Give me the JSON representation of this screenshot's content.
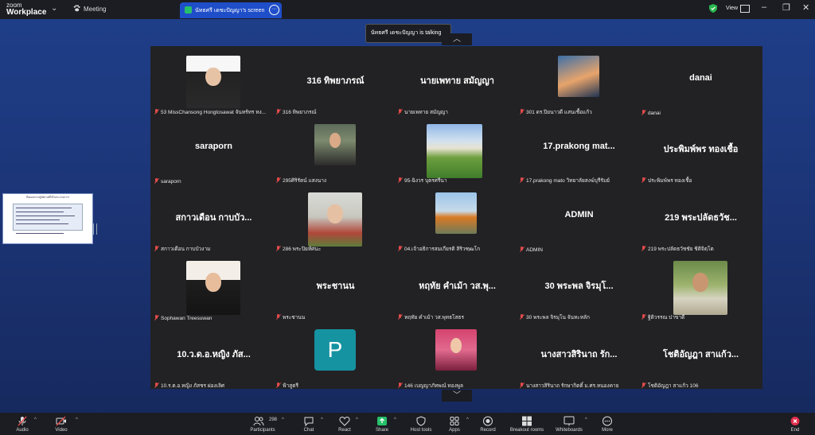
{
  "app": {
    "logo_top": "zoom",
    "logo_bottom": "Workplace",
    "meeting_label": "Meeting"
  },
  "share_tab": {
    "title": "นัทธศรี เดชะปัญญา's screen",
    "more": "···"
  },
  "topbar_right": {
    "view_label": "View",
    "minimize": "–",
    "restore": "❐",
    "close": "✕"
  },
  "talking": "นัทธศรี เดชะปัญญา is talking...",
  "carets": {
    "up": "︿",
    "down": "﹀"
  },
  "tiles": [
    {
      "type": "photo",
      "name": "53 MissChansong Hongtosawat จันทร์ทร หง..."
    },
    {
      "type": "text",
      "big": "316 ทิพยาภรณ์",
      "name": "316 ทิพยาภรณ์"
    },
    {
      "type": "text",
      "big": "นายเพทาย สมัญญา",
      "name": "นายเพทาย สมัญญา"
    },
    {
      "type": "photo",
      "name": "301 ดร.ปิยนาวดี แสนเชื้อแก้ว"
    },
    {
      "type": "text",
      "big": "danai",
      "name": "danai"
    },
    {
      "type": "text",
      "big": "saraporn",
      "name": "saraporn"
    },
    {
      "type": "photo",
      "name": "295ศิริรัตน์ แสงนาง"
    },
    {
      "type": "photo",
      "name": "95-ฉิงวร บุตรศรีนา"
    },
    {
      "type": "text",
      "big": "17.prakong mat...",
      "name": "17.prakong mato วิทยาลัยสงฆ์บุรีรัมย์"
    },
    {
      "type": "text",
      "big": "ประพิมพ์พร ทองเชื้อ",
      "name": "ประพิมพ์พร ทองเชื้อ"
    },
    {
      "type": "text",
      "big": "สกาวเดือน กาบบัว...",
      "name": "สกาวเดือน กาบบัวงาม"
    },
    {
      "type": "photo",
      "name": "286 พระปิยทัศนะ"
    },
    {
      "type": "photo",
      "name": "04.เจ้าอธิการสมเกียรติ สิริวฑฺฒโก"
    },
    {
      "type": "text",
      "big": "ADMIN",
      "name": "ADMIN"
    },
    {
      "type": "text",
      "big": "219 พระปลัดธวัช...",
      "name": "219 พระปลัดธวัชชัย ชิติจิตฺโต"
    },
    {
      "type": "photo",
      "name": "Sophawan Treesuwan"
    },
    {
      "type": "text",
      "big": "พระชานน",
      "name": "พระชานน"
    },
    {
      "type": "text",
      "big": "หฤทัย คำเม้า วส.พุ...",
      "name": "หฤทัย คำเม้า วส.พุทธโสธร"
    },
    {
      "type": "text",
      "big": "30 พระพล จิรมุโ...",
      "name": "30 พระพล จิรมุโน จันทะหลัก"
    },
    {
      "type": "photo",
      "name": "ฐิติวรรณ ปาขาดี"
    },
    {
      "type": "text",
      "big": "10.ว.ด.อ.หญิง ภัส...",
      "name": "10.ร.ต.อ.หญิง ภัสชร ผ่องเลิศ"
    },
    {
      "type": "avatar",
      "letter": "P",
      "name": "ฟ้าสูตรี"
    },
    {
      "type": "photo",
      "name": "146 เบญญาภัทพณ์ ทองพูล"
    },
    {
      "type": "text",
      "big": "นางสาวสิรินาถ รัก...",
      "name": "นางสาวสิรินาถ รักษากิตติ์ ม.ศร.หนองคาย"
    },
    {
      "type": "text",
      "big": "โชติอัญฎา สาแก้ว...",
      "name": "โชติอัญฎา สาแก้ว 106"
    }
  ],
  "thumb": {
    "title": "ขั้นตอนการปฏิบัติงานที่ใช้ในกระบวนการฯ"
  },
  "toolbar": {
    "audio": "Audio",
    "video": "Video",
    "participants": "Participants",
    "participants_count": "298",
    "chat": "Chat",
    "react": "React",
    "share": "Share",
    "host_tools": "Host tools",
    "apps": "Apps",
    "record": "Record",
    "breakout": "Breakout rooms",
    "whiteboards": "Whiteboards",
    "more": "More",
    "end": "End"
  },
  "colors": {
    "accent_blue": "#1f4ec9",
    "share_green": "#27c06a",
    "end_red": "#e02e4c",
    "muted_red": "#e24b4b",
    "avatar_teal": "#1593a1"
  }
}
